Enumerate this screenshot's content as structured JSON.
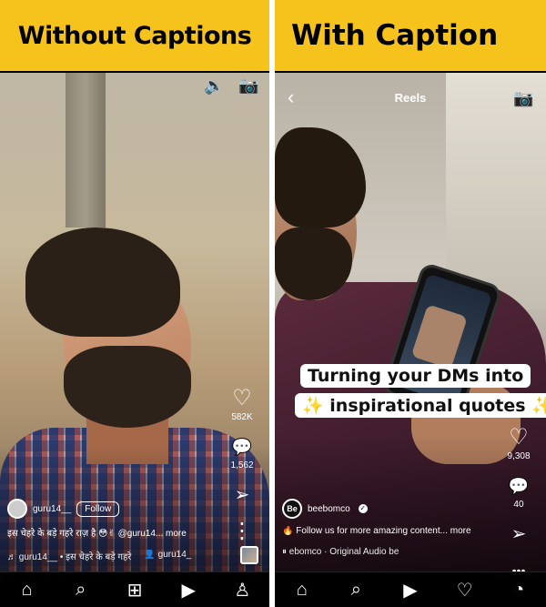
{
  "left": {
    "banner": "Without Captions",
    "top_icons": {
      "sound": "🔈",
      "camera": "📷"
    },
    "actions": {
      "like_icon": "♡",
      "like_count": "582K",
      "comment_icon": "💬",
      "comment_count": "1,562",
      "share_icon": "➢",
      "more_icon": "⋮"
    },
    "user": {
      "name": "guru14__",
      "follow": "Follow"
    },
    "description": "इस चेहरे के बड़े गहरे राज़ है 😳✌ @guru14... more",
    "audio": {
      "left": "♬ guru14__ • इस चेहरे के बड़े गहरे",
      "right": "👤 guru14_"
    },
    "nav": {
      "home": "⌂",
      "search": "⌕",
      "create": "⊞",
      "reels": "▶",
      "profile": "♙"
    }
  },
  "right": {
    "banner": "With Caption",
    "top_icons": {
      "back": "‹",
      "camera": "📷"
    },
    "reels_title": "Reels",
    "caption": {
      "line1": "Turning your DMs into",
      "line2": "inspirational quotes",
      "spark_left": "✨",
      "spark_right": "✨"
    },
    "actions": {
      "like_icon": "♡",
      "like_count": "9,308",
      "comment_icon": "💬",
      "comment_count": "40",
      "share_icon": "➢",
      "more_icon": "•••"
    },
    "user": {
      "avatar": "Be",
      "name": "beebomco"
    },
    "description": "🔥 Follow us for more amazing content... more",
    "audio": "⏸ ebomco · Original Audio  be",
    "nav": {
      "home": "⌂",
      "search": "⌕",
      "reels": "▶",
      "activity": "♡",
      "profile": "◔"
    }
  }
}
